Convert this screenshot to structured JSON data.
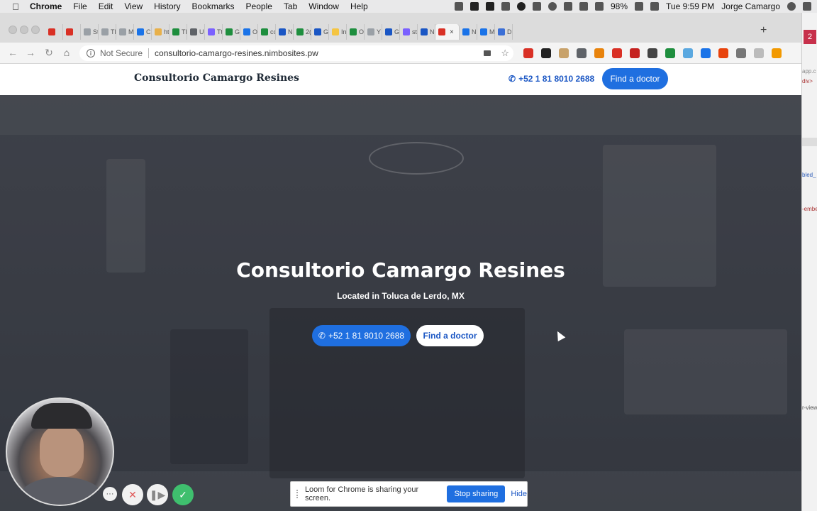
{
  "menubar": {
    "app": "Chrome",
    "items": [
      "File",
      "Edit",
      "View",
      "History",
      "Bookmarks",
      "People",
      "Tab",
      "Window",
      "Help"
    ],
    "battery": "98%",
    "clock": "Tue 9:59 PM",
    "user": "Jorge Camargo"
  },
  "browser": {
    "tabs": [
      {
        "label": "",
        "color": "#d93025"
      },
      {
        "label": "",
        "color": "#d93025"
      },
      {
        "label": "St",
        "color": "#9aa0a6"
      },
      {
        "label": "Tl",
        "color": "#9aa0a6"
      },
      {
        "label": "M",
        "color": "#9aa0a6"
      },
      {
        "label": "C",
        "color": "#1a73e8"
      },
      {
        "label": "ht",
        "color": "#e8b04a"
      },
      {
        "label": "Tl",
        "color": "#1e8e3e"
      },
      {
        "label": "U",
        "color": "#5f6368"
      },
      {
        "label": "Tt",
        "color": "#7b61ff"
      },
      {
        "label": "G",
        "color": "#1e8e3e"
      },
      {
        "label": "O",
        "color": "#1a73e8"
      },
      {
        "label": "cc",
        "color": "#1e8e3e"
      },
      {
        "label": "N",
        "color": "#1a56c4"
      },
      {
        "label": "2(",
        "color": "#1e8e3e"
      },
      {
        "label": "G",
        "color": "#1a56c4"
      },
      {
        "label": "In",
        "color": "#f5c542"
      },
      {
        "label": "O",
        "color": "#1e8e3e"
      },
      {
        "label": "Y",
        "color": "#9aa0a6"
      },
      {
        "label": "G",
        "color": "#1a56c4"
      },
      {
        "label": "st",
        "color": "#7b61ff"
      },
      {
        "label": "N",
        "color": "#1a56c4"
      },
      {
        "label": "",
        "color": "#d93025",
        "active": true
      },
      {
        "label": "N",
        "color": "#1a73e8"
      },
      {
        "label": "M",
        "color": "#1a73e8"
      },
      {
        "label": "D",
        "color": "#3b6fd6"
      }
    ],
    "security_label": "Not Secure",
    "url": "consultorio-camargo-resines.nimbosites.pw",
    "extension_colors": [
      "#d93025",
      "#222222",
      "#c8a26a",
      "#5f6368",
      "#e8830c",
      "#d93025",
      "#c5221f",
      "#444444",
      "#1e8e3e",
      "#5aa8e0",
      "#1a73e8",
      "#e8430c",
      "#777777",
      "#bbbbbb",
      "#f29900"
    ]
  },
  "site": {
    "brand": "Consultorio Camargo Resines",
    "nav_phone": "+52 1 81 8010 2688",
    "nav_cta": "Find a doctor",
    "hero_title": "Consultorio Camargo Resines",
    "hero_subtitle": "Located in Toluca de Lerdo, MX",
    "hero_phone": "+52 1 81 8010 2688",
    "hero_cta": "Find a doctor"
  },
  "devtools": {
    "badge": "2",
    "snippets": [
      "app.c",
      "div>",
      "bled_",
      "-embe",
      "r-view"
    ]
  },
  "loom": {
    "message": "Loom for Chrome is sharing your screen.",
    "stop_label": "Stop sharing",
    "hide_label": "Hide",
    "more_glyph": "···",
    "cancel_glyph": "✕",
    "pause_glyph": "❚▶",
    "done_glyph": "✓"
  }
}
